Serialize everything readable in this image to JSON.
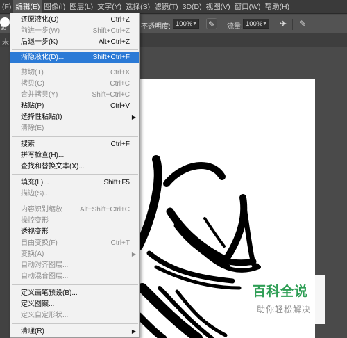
{
  "menubar": {
    "items": [
      {
        "label": "(F)"
      },
      {
        "label": "编辑(E)"
      },
      {
        "label": "图像(I)"
      },
      {
        "label": "图层(L)"
      },
      {
        "label": "文字(Y)"
      },
      {
        "label": "选择(S)"
      },
      {
        "label": "滤镜(T)"
      },
      {
        "label": "3D(D)"
      },
      {
        "label": "视图(V)"
      },
      {
        "label": "窗口(W)"
      },
      {
        "label": "帮助(H)"
      }
    ]
  },
  "options_bar": {
    "brush_size": "30",
    "opacity_label": "不透明度:",
    "opacity_value": "100%",
    "flow_label": "流量:",
    "flow_value": "100%"
  },
  "tab": {
    "close_glyph": "未"
  },
  "edit_menu": {
    "items": [
      {
        "label": "还原液化(O)",
        "shortcut": "Ctrl+Z",
        "disabled": false
      },
      {
        "label": "前进一步(W)",
        "shortcut": "Shift+Ctrl+Z",
        "disabled": true
      },
      {
        "label": "后退一步(K)",
        "shortcut": "Alt+Ctrl+Z",
        "disabled": false
      },
      {
        "label": "渐隐液化(D)...",
        "shortcut": "Shift+Ctrl+F",
        "disabled": false,
        "highlighted": true
      },
      {
        "label": "剪切(T)",
        "shortcut": "Ctrl+X",
        "disabled": true
      },
      {
        "label": "拷贝(C)",
        "shortcut": "Ctrl+C",
        "disabled": true
      },
      {
        "label": "合并拷贝(Y)",
        "shortcut": "Shift+Ctrl+C",
        "disabled": true
      },
      {
        "label": "粘贴(P)",
        "shortcut": "Ctrl+V",
        "disabled": false
      },
      {
        "label": "选择性粘贴(I)",
        "shortcut": "",
        "disabled": false,
        "submenu": true
      },
      {
        "label": "清除(E)",
        "shortcut": "",
        "disabled": true
      },
      {
        "label": "搜索",
        "shortcut": "Ctrl+F",
        "disabled": false
      },
      {
        "label": "拼写检查(H)...",
        "shortcut": "",
        "disabled": false
      },
      {
        "label": "查找和替换文本(X)...",
        "shortcut": "",
        "disabled": false
      },
      {
        "label": "填充(L)...",
        "shortcut": "Shift+F5",
        "disabled": false
      },
      {
        "label": "描边(S)...",
        "shortcut": "",
        "disabled": true
      },
      {
        "label": "内容识别缩放",
        "shortcut": "Alt+Shift+Ctrl+C",
        "disabled": true
      },
      {
        "label": "操控变形",
        "shortcut": "",
        "disabled": true
      },
      {
        "label": "透视变形",
        "shortcut": "",
        "disabled": false
      },
      {
        "label": "自由变换(F)",
        "shortcut": "Ctrl+T",
        "disabled": true
      },
      {
        "label": "变换(A)",
        "shortcut": "",
        "disabled": true,
        "submenu": true
      },
      {
        "label": "自动对齐图层...",
        "shortcut": "",
        "disabled": true
      },
      {
        "label": "自动混合图层...",
        "shortcut": "",
        "disabled": true
      },
      {
        "label": "定义画笔预设(B)...",
        "shortcut": "",
        "disabled": false
      },
      {
        "label": "定义图案...",
        "shortcut": "",
        "disabled": false
      },
      {
        "label": "定义自定形状...",
        "shortcut": "",
        "disabled": true
      },
      {
        "label": "清理(R)",
        "shortcut": "",
        "disabled": false,
        "submenu": true
      }
    ]
  },
  "watermark": {
    "title": "百科全说",
    "subtitle": "助你轻松解决"
  },
  "colors": {
    "highlight": "#2b7ad6",
    "menu_bg": "#f2f2f2",
    "watermark_green": "#2e9e55"
  }
}
